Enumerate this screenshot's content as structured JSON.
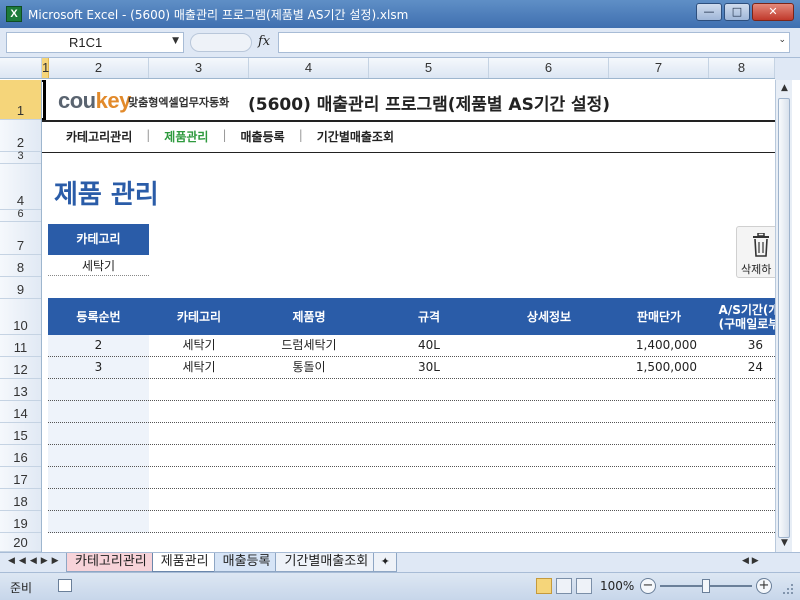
{
  "window": {
    "title": "Microsoft Excel - (5600) 매출관리 프로그램(제품별 AS기간 설정).xlsm",
    "app_icon": "X"
  },
  "formula_bar": {
    "name_box": "R1C1",
    "fx": "fx",
    "formula": ""
  },
  "columns": [
    "1",
    "2",
    "3",
    "4",
    "5",
    "6",
    "7",
    "8"
  ],
  "rows": [
    "1",
    "2",
    "3",
    "4",
    "6",
    "7",
    "8",
    "9",
    "10",
    "11",
    "12",
    "13",
    "14",
    "15",
    "16",
    "17",
    "18",
    "19",
    "20"
  ],
  "logo": {
    "co": "cou",
    "key": "key",
    "subtitle": "맞춤형엑셀업무자동화"
  },
  "program_title": "(5600) 매출관리 프로그램(제품별 AS기간 설정)",
  "nav": {
    "items": [
      "카테고리관리",
      "제품관리",
      "매출등록",
      "기간별매출조회"
    ],
    "active_index": 1,
    "separator": "|"
  },
  "page_title": "제품 관리",
  "category_filter": {
    "label": "카테고리",
    "value": "세탁기"
  },
  "delete_button": {
    "label": "삭제하"
  },
  "table": {
    "headers": [
      "등록순번",
      "카테고리",
      "제품명",
      "규격",
      "상세정보",
      "판매단가",
      "A/S기간(개",
      "(구매일로부"
    ],
    "rows": [
      {
        "seq": "2",
        "category": "세탁기",
        "name": "드럼세탁기",
        "spec": "40L",
        "detail": "",
        "price": "1,400,000",
        "as_period": "36"
      },
      {
        "seq": "3",
        "category": "세탁기",
        "name": "통돌이",
        "spec": "30L",
        "detail": "",
        "price": "1,500,000",
        "as_period": "24"
      }
    ]
  },
  "sheet_tabs": [
    {
      "label": "카테고리관리",
      "style": "pink"
    },
    {
      "label": "제품관리",
      "style": "active"
    },
    {
      "label": "매출등록",
      "style": "blue"
    },
    {
      "label": "기간별매출조회",
      "style": "plain"
    }
  ],
  "status": {
    "ready": "준비",
    "zoom": "100%"
  },
  "colors": {
    "accent_blue": "#2a5ca8",
    "nav_active": "#2e9a3e",
    "logo_orange": "#e28a2b"
  }
}
